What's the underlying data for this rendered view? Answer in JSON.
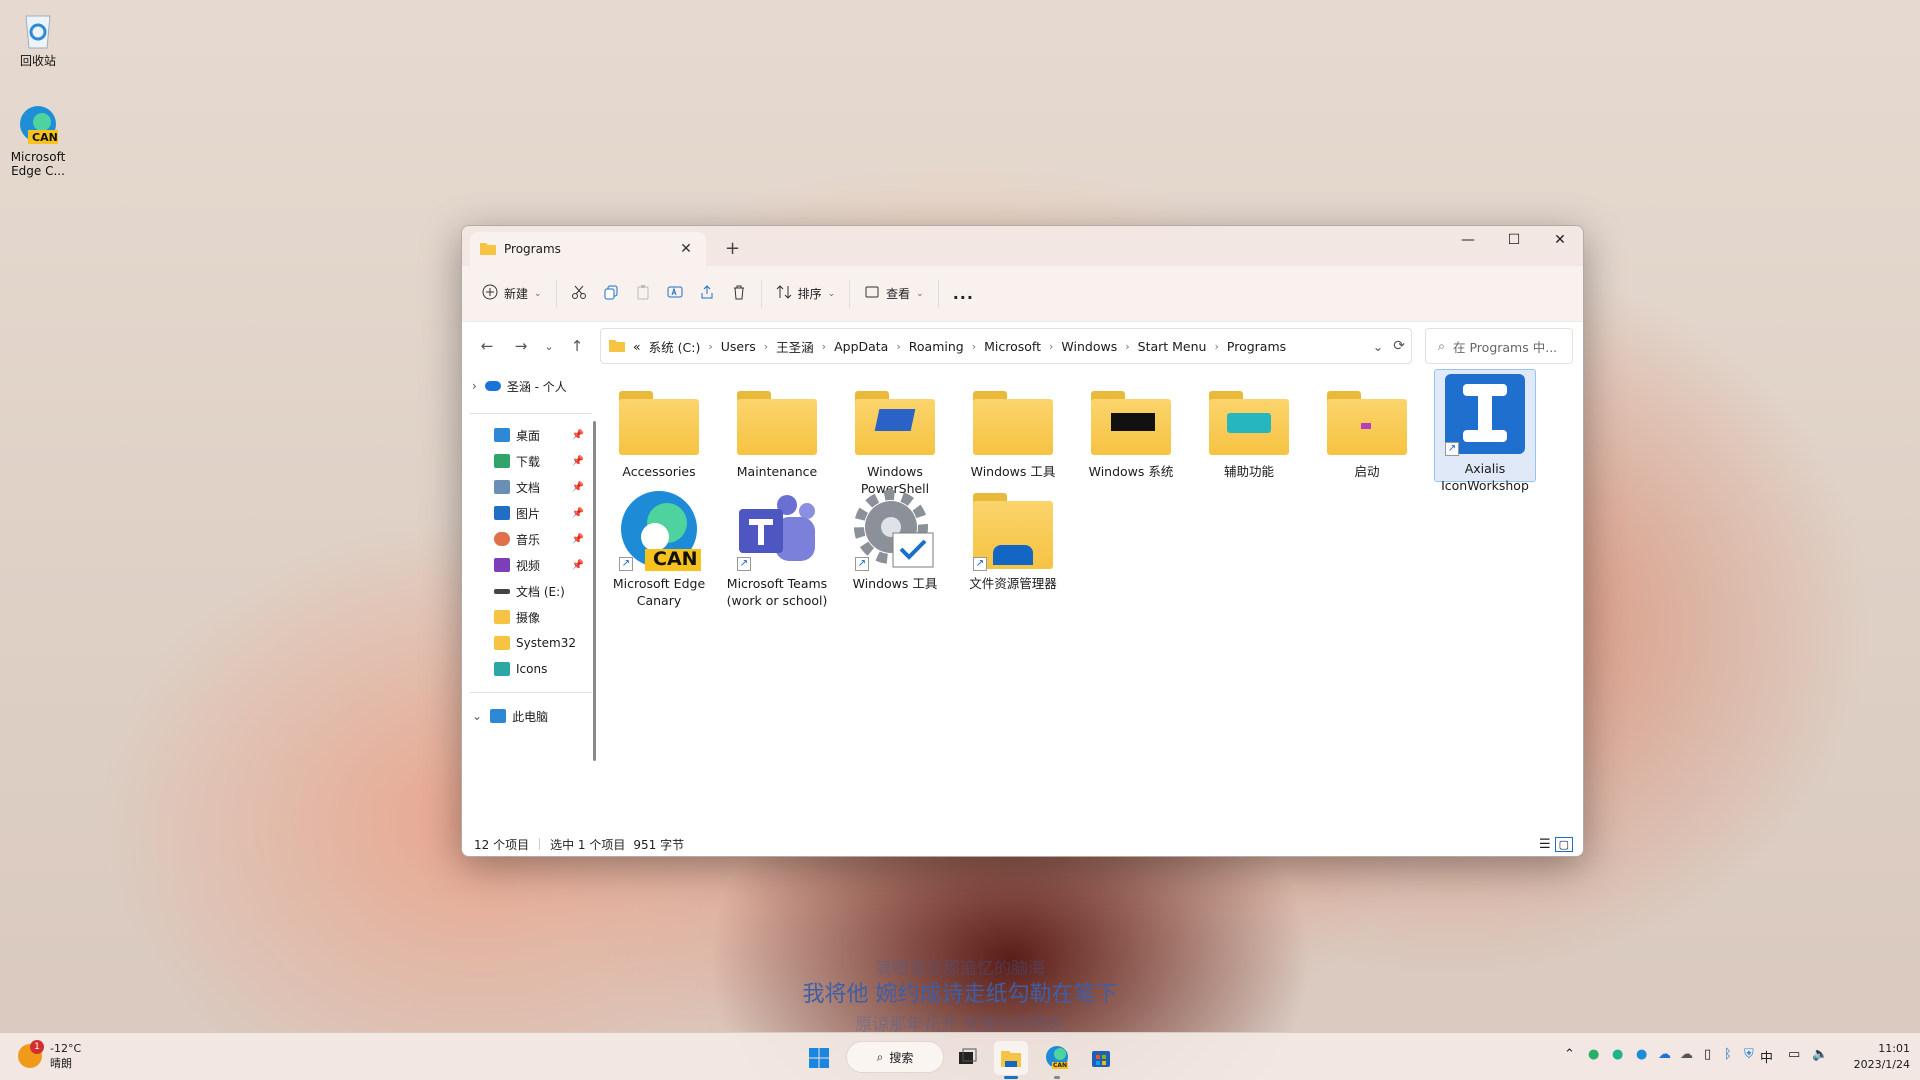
{
  "desktop": {
    "icons": [
      {
        "label": "回收站"
      },
      {
        "label": "Microsoft Edge C...",
        "badge": "CAN"
      }
    ]
  },
  "window": {
    "tab_title": "Programs",
    "toolbar": {
      "new_label": "新建",
      "sort_label": "排序",
      "view_label": "查看",
      "more_label": "..."
    },
    "breadcrumbs": [
      "«",
      "系统 (C:)",
      "Users",
      "王圣涵",
      "AppData",
      "Roaming",
      "Microsoft",
      "Windows",
      "Start Menu",
      "Programs"
    ],
    "search_placeholder": "在 Programs 中...",
    "sidebar": {
      "onedrive": "圣涵 - 个人",
      "quick": [
        {
          "label": "桌面",
          "icon": "desktop-icon",
          "pinned": true
        },
        {
          "label": "下载",
          "icon": "download-icon",
          "pinned": true
        },
        {
          "label": "文档",
          "icon": "document-icon",
          "pinned": true
        },
        {
          "label": "图片",
          "icon": "pictures-icon",
          "pinned": true
        },
        {
          "label": "音乐",
          "icon": "music-icon",
          "pinned": true
        },
        {
          "label": "视频",
          "icon": "video-icon",
          "pinned": true
        },
        {
          "label": "文档 (E:)",
          "icon": "drive-icon",
          "pinned": false
        },
        {
          "label": "摄像",
          "icon": "folder-icon",
          "pinned": false
        },
        {
          "label": "System32",
          "icon": "folder-icon",
          "pinned": false
        },
        {
          "label": "Icons",
          "icon": "folder-icon",
          "pinned": false
        }
      ],
      "this_pc": "此电脑"
    },
    "files": [
      {
        "label": "Accessories",
        "type": "folder"
      },
      {
        "label": "Maintenance",
        "type": "folder"
      },
      {
        "label": "Windows PowerShell",
        "type": "folder-ps"
      },
      {
        "label": "Windows 工具",
        "type": "folder"
      },
      {
        "label": "Windows 系统",
        "type": "folder-sys"
      },
      {
        "label": "辅助功能",
        "type": "folder-access"
      },
      {
        "label": "启动",
        "type": "folder-start"
      },
      {
        "label": "Axialis IconWorkshop",
        "type": "app-axialis",
        "selected": true
      },
      {
        "label": "Microsoft Edge Canary",
        "type": "app-edge",
        "badge": "CAN"
      },
      {
        "label": "Microsoft Teams (work or school)",
        "type": "app-teams"
      },
      {
        "label": "Windows 工具",
        "type": "app-tools"
      },
      {
        "label": "文件资源管理器",
        "type": "app-explorer"
      }
    ],
    "status": {
      "count": "12 个项目",
      "selected": "选中 1 个项目",
      "size": "951 字节"
    }
  },
  "subtitles": {
    "line1": "满眼皆在那追忆的脑海",
    "line2": "我将他 婉约成诗走纸勾勒在笔下",
    "line3": "原谅那年花开 未曾与你同在"
  },
  "taskbar": {
    "weather_temp": "-12°C",
    "weather_desc": "晴朗",
    "weather_badge": "1",
    "search_label": "搜索",
    "ime": "中",
    "time": "11:01",
    "date": "2023/1/24",
    "edge_badge": "CAN"
  }
}
